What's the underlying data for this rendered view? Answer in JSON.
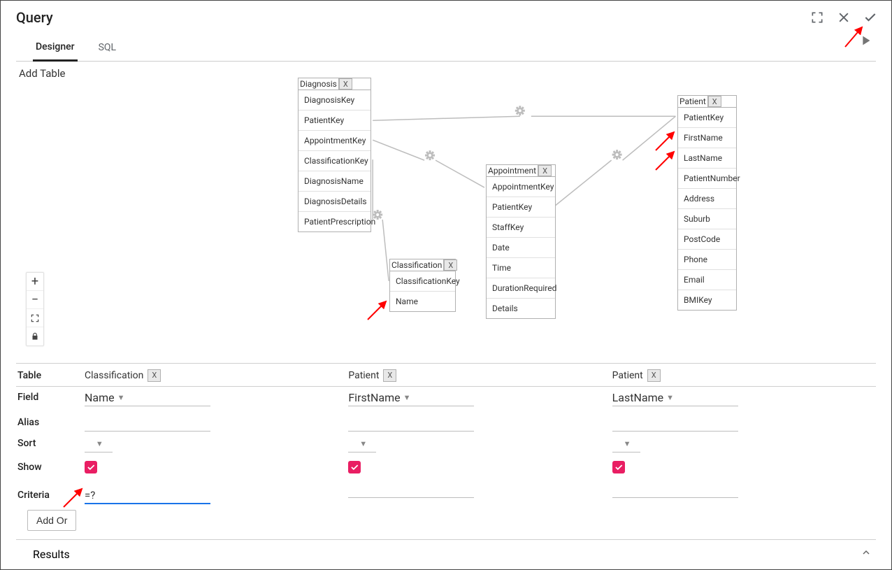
{
  "header": {
    "title": "Query"
  },
  "tabs": {
    "designer": "Designer",
    "sql": "SQL"
  },
  "add_table": "Add Table",
  "tables": {
    "diagnosis": {
      "name": "Diagnosis",
      "fields": [
        "DiagnosisKey",
        "PatientKey",
        "AppointmentKey",
        "ClassificationKey",
        "DiagnosisName",
        "DiagnosisDetails",
        "PatientPrescription"
      ]
    },
    "classification": {
      "name": "Classification",
      "fields": [
        "ClassificationKey",
        "Name"
      ]
    },
    "appointment": {
      "name": "Appointment",
      "fields": [
        "AppointmentKey",
        "PatientKey",
        "StaffKey",
        "Date",
        "Time",
        "DurationRequired",
        "Details"
      ]
    },
    "patient": {
      "name": "Patient",
      "fields": [
        "PatientKey",
        "FirstName",
        "LastName",
        "PatientNumber",
        "Address",
        "Suburb",
        "PostCode",
        "Phone",
        "Email",
        "BMIKey"
      ]
    }
  },
  "grid": {
    "labels": {
      "table": "Table",
      "field": "Field",
      "alias": "Alias",
      "sort": "Sort",
      "show": "Show",
      "criteria": "Criteria"
    },
    "cols": [
      {
        "table": "Classification",
        "field": "Name",
        "criteria": "=?"
      },
      {
        "table": "Patient",
        "field": "FirstName",
        "criteria": ""
      },
      {
        "table": "Patient",
        "field": "LastName",
        "criteria": ""
      }
    ],
    "add_or": "Add Or",
    "x": "X"
  },
  "results_label": "Results"
}
